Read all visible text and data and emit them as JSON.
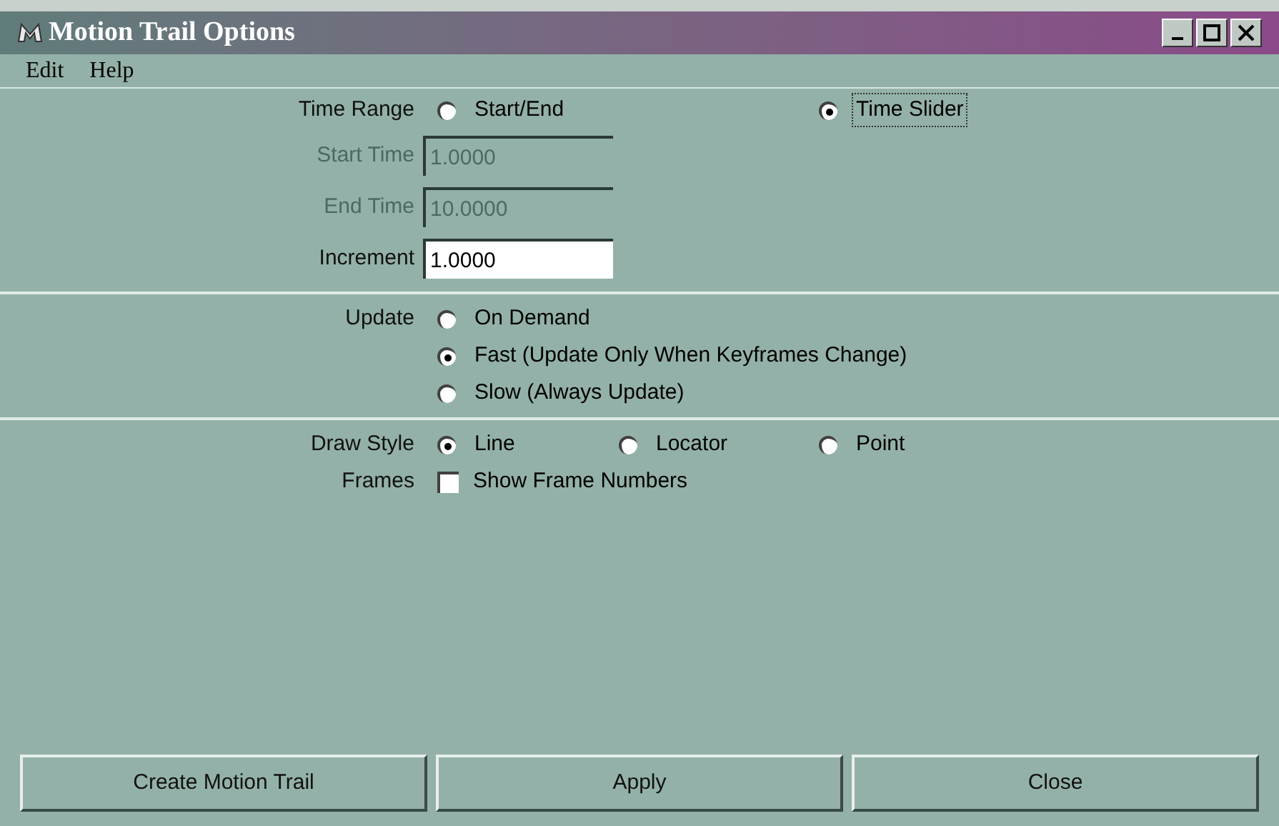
{
  "window": {
    "title": "Motion Trail Options"
  },
  "menu": [
    "Edit",
    "Help"
  ],
  "time_range": {
    "label": "Time Range",
    "options": [
      {
        "label": "Start/End",
        "selected": false,
        "focused": false
      },
      {
        "label": "Time Slider",
        "selected": true,
        "focused": true
      }
    ]
  },
  "fields": [
    {
      "label": "Start Time",
      "value": "1.0000",
      "disabled": true
    },
    {
      "label": "End Time",
      "value": "10.0000",
      "disabled": true
    },
    {
      "label": "Increment",
      "value": "1.0000",
      "disabled": false
    }
  ],
  "update": {
    "label": "Update",
    "options": [
      {
        "label": "On Demand",
        "selected": false
      },
      {
        "label": "Fast (Update Only When Keyframes Change)",
        "selected": true
      },
      {
        "label": "Slow (Always Update)",
        "selected": false
      }
    ]
  },
  "draw_style": {
    "label": "Draw Style",
    "options": [
      {
        "label": "Line",
        "selected": true
      },
      {
        "label": "Locator",
        "selected": false
      },
      {
        "label": "Point",
        "selected": false
      }
    ]
  },
  "frames": {
    "label": "Frames",
    "checkbox_label": "Show Frame Numbers",
    "checked": false
  },
  "buttons": [
    "Create Motion Trail",
    "Apply",
    "Close"
  ]
}
